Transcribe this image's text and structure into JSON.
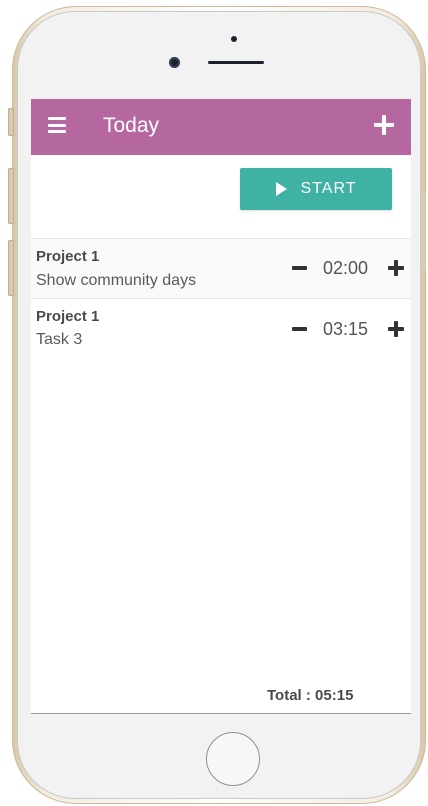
{
  "header": {
    "title": "Today",
    "menu_icon": "menu-icon",
    "add_icon": "plus-icon",
    "color": "#b5689f"
  },
  "start_button": {
    "label": "START",
    "icon": "play-icon",
    "color": "#3fb2a3"
  },
  "tasks": [
    {
      "project": "Project 1",
      "name": "Show community days",
      "time": "02:00"
    },
    {
      "project": "Project 1",
      "name": "Task 3",
      "time": "03:15"
    }
  ],
  "total": "Total : 05:15"
}
